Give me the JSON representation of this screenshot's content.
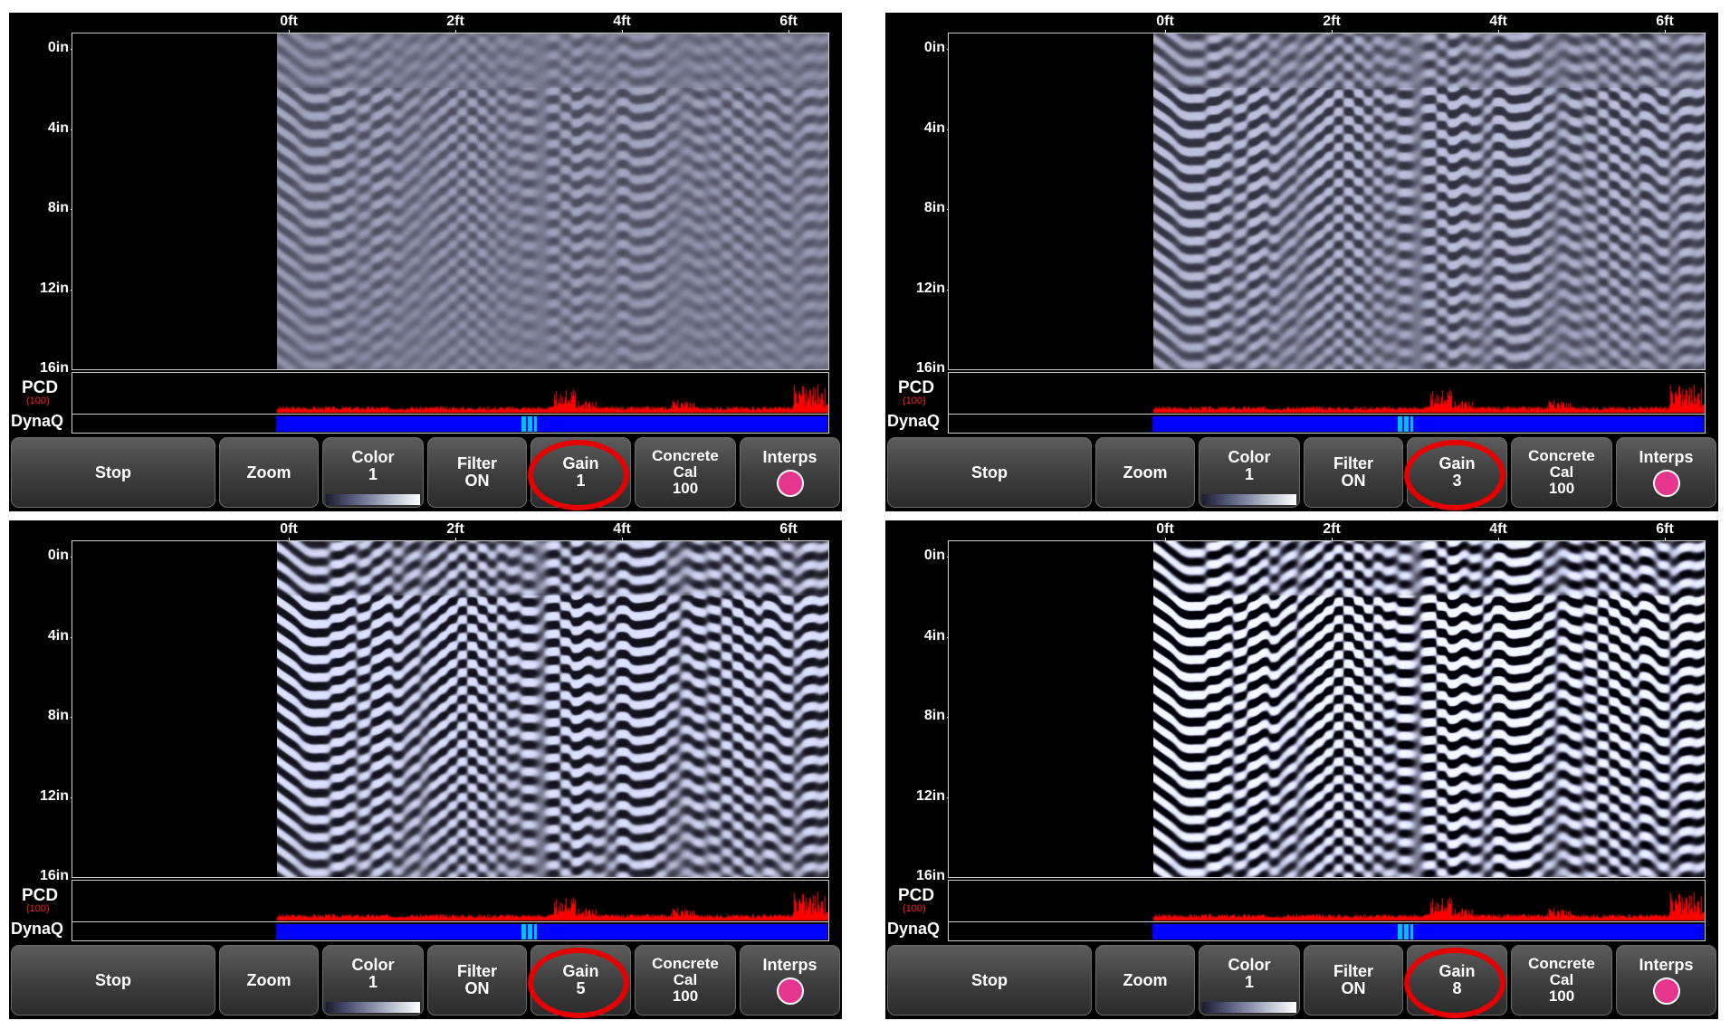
{
  "ruler": {
    "labels": [
      "0ft",
      "2ft",
      "4ft",
      "6ft"
    ]
  },
  "depth": {
    "labels": [
      "0in",
      "4in",
      "8in",
      "12in",
      "16in"
    ]
  },
  "pcd": {
    "label": "PCD",
    "sub": "(100)"
  },
  "dynaq": {
    "label": "DynaQ"
  },
  "buttons": {
    "stop": "Stop",
    "zoom": "Zoom",
    "color": "Color",
    "color_value": "1",
    "filter": "Filter",
    "filter_value": "ON",
    "gain": "Gain",
    "concrete_l1": "Concrete",
    "concrete_l2": "Cal",
    "concrete_value": "100",
    "interps": "Interps"
  },
  "panels": [
    {
      "gain_value": "1",
      "contrast": 0.18
    },
    {
      "gain_value": "3",
      "contrast": 0.42
    },
    {
      "gain_value": "5",
      "contrast": 0.75
    },
    {
      "gain_value": "8",
      "contrast": 1.0
    }
  ],
  "colors": {
    "pcd_fill": "#ff0000",
    "dynaq_fill": "#0000ff",
    "dynaq_marker": "#00bfff",
    "highlight_circle": "#e60000",
    "interps_dot": "#e6358c",
    "scan_base": "#7c8296"
  }
}
